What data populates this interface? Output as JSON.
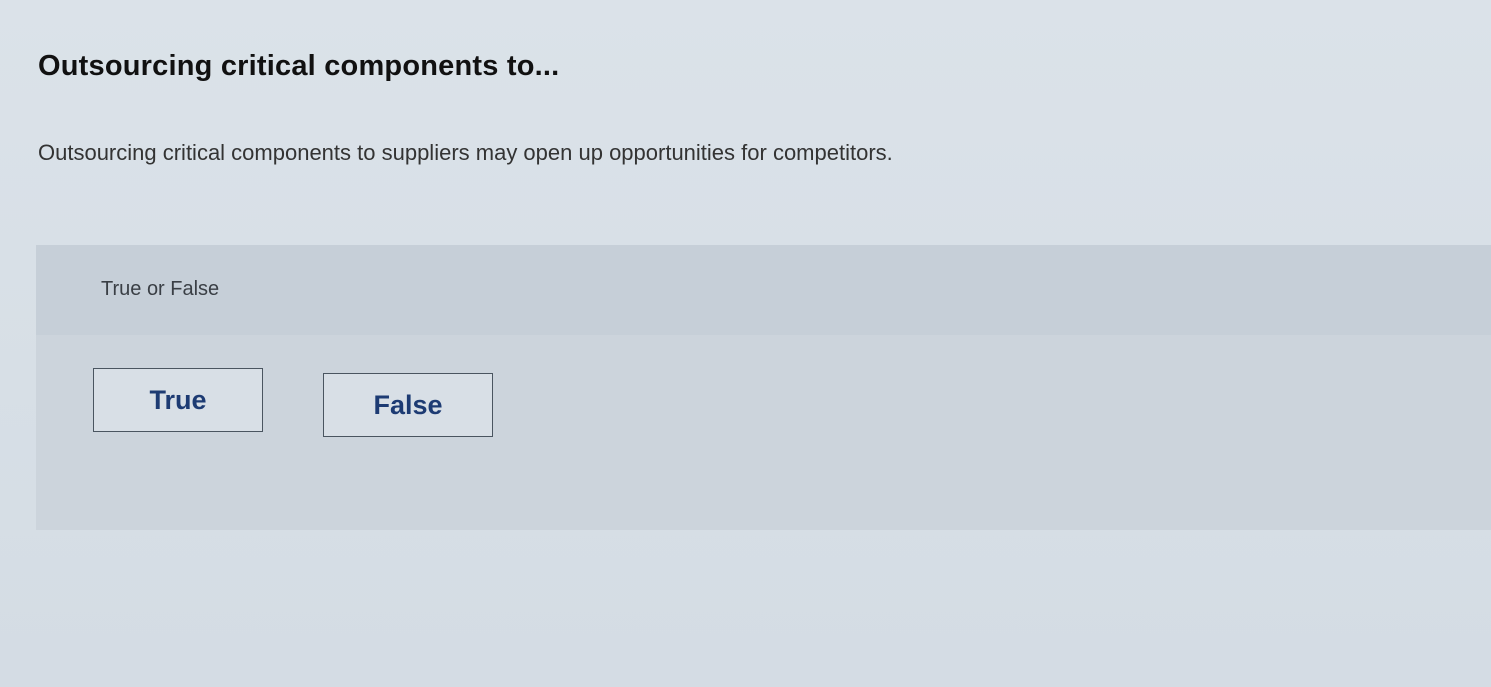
{
  "question": {
    "title": "Outsourcing critical components to...",
    "text": "Outsourcing critical components to suppliers may open up opportunities for competitors."
  },
  "answer": {
    "prompt": "True or False",
    "options": [
      {
        "label": "True"
      },
      {
        "label": "False"
      }
    ]
  },
  "colors": {
    "button_text": "#1d3b73",
    "panel_background": "#ccd4dc"
  }
}
